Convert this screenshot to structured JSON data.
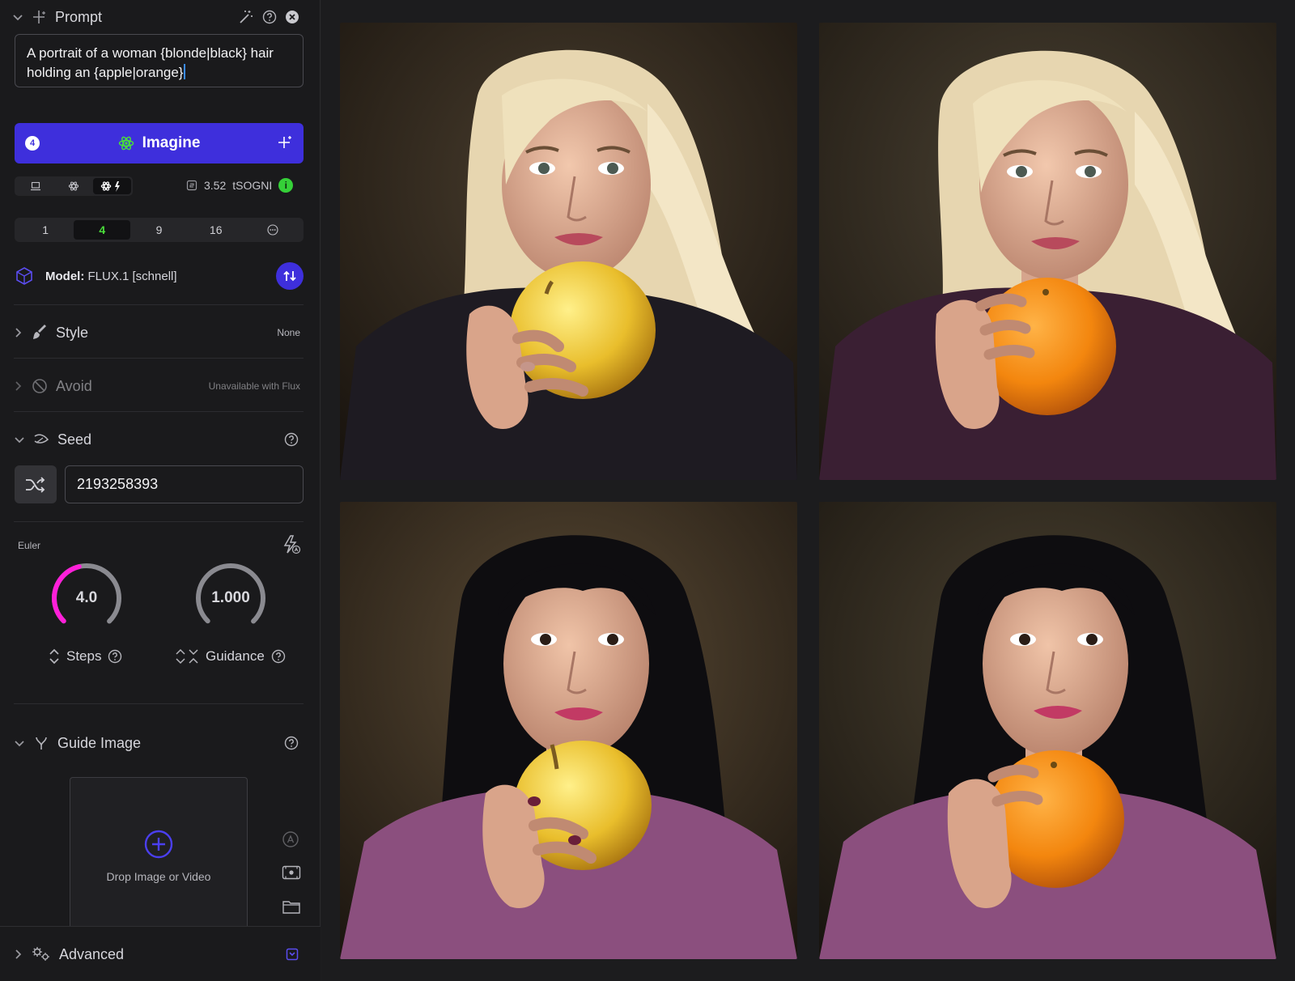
{
  "prompt": {
    "title": "Prompt",
    "text": "A portrait of a woman {blonde|black} hair holding an {apple|orange}"
  },
  "imagine": {
    "badge": "4",
    "label": "Imagine"
  },
  "cost": {
    "value": "3.52",
    "unit": "tSOGNI",
    "info": "i"
  },
  "counts": {
    "options": [
      "1",
      "4",
      "9",
      "16"
    ],
    "selected": "4"
  },
  "model": {
    "label": "Model:",
    "name": "FLUX.1 [schnell]"
  },
  "style": {
    "label": "Style",
    "value": "None"
  },
  "avoid": {
    "label": "Avoid",
    "value": "Unavailable with Flux"
  },
  "seed": {
    "label": "Seed",
    "value": "2193258393"
  },
  "sampler": {
    "name": "Euler"
  },
  "steps": {
    "value": "4.0",
    "label": "Steps",
    "level": 0.45,
    "color": "#ff1fd9"
  },
  "guidance": {
    "value": "1.000",
    "label": "Guidance",
    "level": 0.0
  },
  "guide_image": {
    "label": "Guide Image",
    "drop_text": "Drop Image or Video"
  },
  "advanced": {
    "label": "Advanced"
  },
  "colors": {
    "accent": "#3e2fdc",
    "success": "#35d038",
    "steps_arc": "#ff1fd9"
  },
  "gallery": {
    "images": [
      {
        "hair": "blonde",
        "fruit": "apple"
      },
      {
        "hair": "blonde",
        "fruit": "orange"
      },
      {
        "hair": "black",
        "fruit": "apple"
      },
      {
        "hair": "black",
        "fruit": "orange"
      }
    ]
  }
}
